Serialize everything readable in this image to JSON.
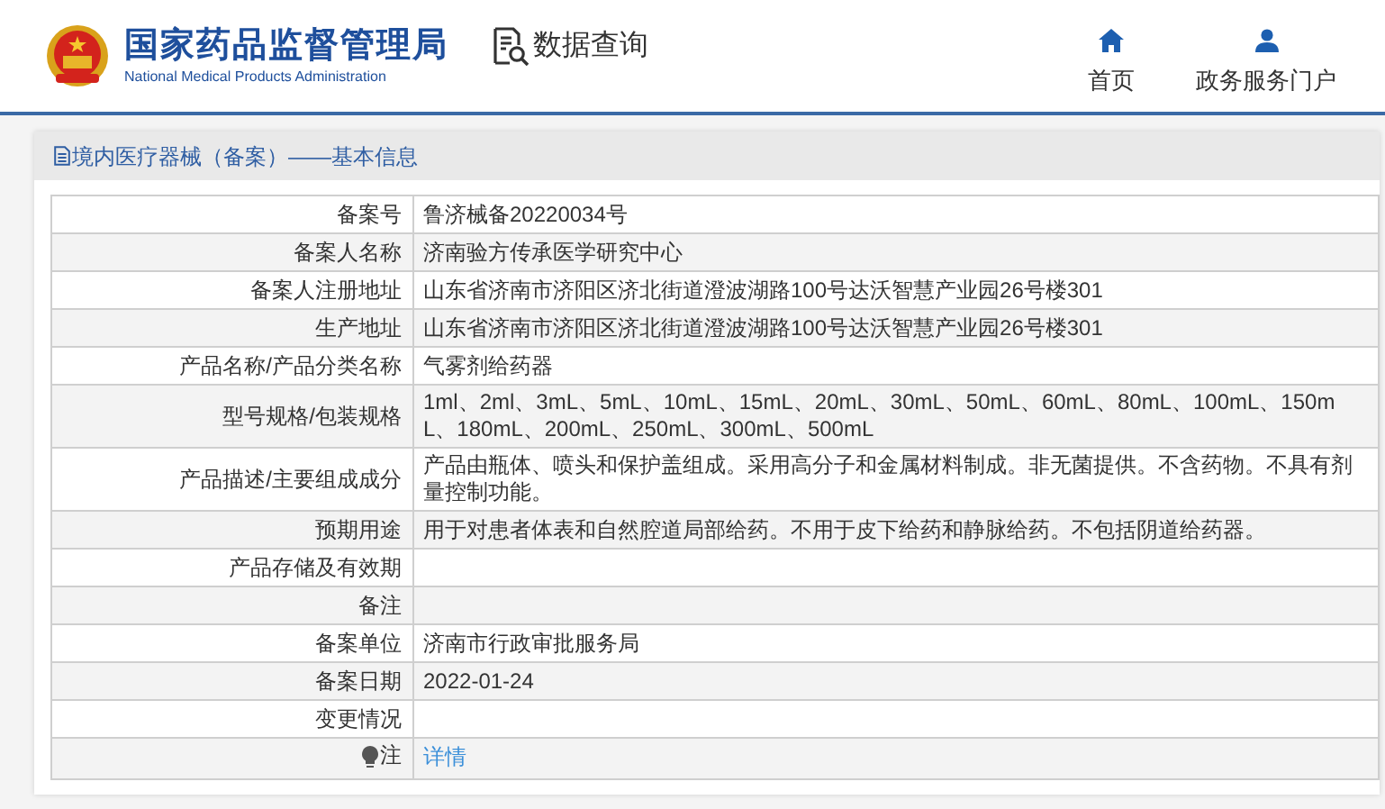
{
  "header": {
    "title": "国家药品监督管理局",
    "subtitle": "National Medical Products Administration",
    "section": "数据查询",
    "nav": [
      {
        "label": "首页",
        "kind": "home"
      },
      {
        "label": "政务服务门户",
        "kind": "user"
      }
    ]
  },
  "panel": {
    "title": "境内医疗器械（备案）——基本信息",
    "rows": [
      {
        "label": "备案号",
        "value": "鲁济械备20220034号"
      },
      {
        "label": "备案人名称",
        "value": "济南验方传承医学研究中心"
      },
      {
        "label": "备案人注册地址",
        "value": "山东省济南市济阳区济北街道澄波湖路100号达沃智慧产业园26号楼301"
      },
      {
        "label": "生产地址",
        "value": "山东省济南市济阳区济北街道澄波湖路100号达沃智慧产业园26号楼301"
      },
      {
        "label": "产品名称/产品分类名称",
        "value": "气雾剂给药器"
      },
      {
        "label": "型号规格/包装规格",
        "value": "1ml、2ml、3mL、5mL、10mL、15mL、20mL、30mL、50mL、60mL、80mL、100mL、150mL、180mL、200mL、250mL、300mL、500mL"
      },
      {
        "label": "产品描述/主要组成成分",
        "value": "产品由瓶体、喷头和保护盖组成。采用高分子和金属材料制成。非无菌提供。不含药物。不具有剂量控制功能。"
      },
      {
        "label": "预期用途",
        "value": "用于对患者体表和自然腔道局部给药。不用于皮下给药和静脉给药。不包括阴道给药器。"
      },
      {
        "label": "产品存储及有效期",
        "value": ""
      },
      {
        "label": "备注",
        "value": ""
      },
      {
        "label": "备案单位",
        "value": "济南市行政审批服务局"
      },
      {
        "label": "备案日期",
        "value": "2022-01-24"
      },
      {
        "label": "变更情况",
        "value": ""
      },
      {
        "label": "注",
        "value": "详情",
        "kind": "note"
      }
    ]
  }
}
